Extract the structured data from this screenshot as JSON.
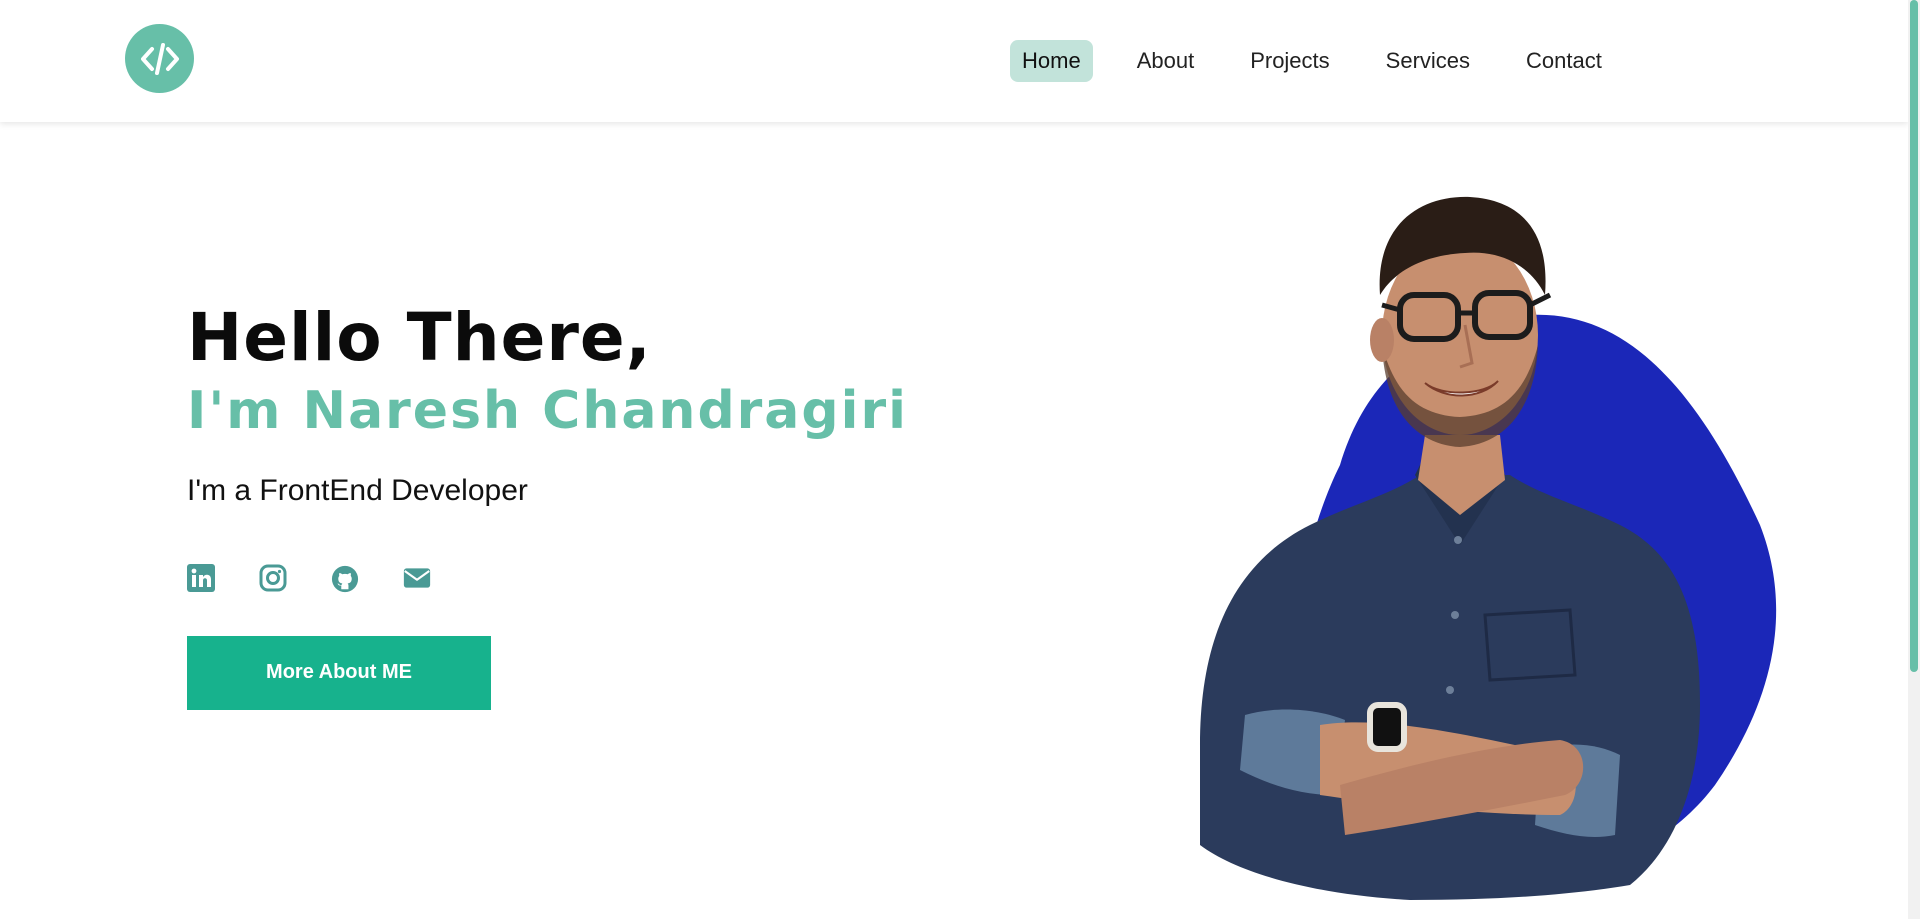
{
  "nav": {
    "items": [
      {
        "label": "Home",
        "active": true
      },
      {
        "label": "About",
        "active": false
      },
      {
        "label": "Projects",
        "active": false
      },
      {
        "label": "Services",
        "active": false
      },
      {
        "label": "Contact",
        "active": false
      }
    ]
  },
  "logo": {
    "icon": "code-brackets-icon"
  },
  "hero": {
    "greeting": "Hello There,",
    "name": "I'm Naresh Chandragiri",
    "role": "I'm a FrontEnd Developer",
    "cta_label": "More About ME"
  },
  "socials": [
    {
      "icon": "linkedin-icon"
    },
    {
      "icon": "instagram-icon"
    },
    {
      "icon": "github-icon"
    },
    {
      "icon": "email-icon"
    }
  ],
  "colors": {
    "accent": "#67bfa8",
    "button": "#17b28d",
    "nav_active_bg": "#c2e3da",
    "social_icon": "#4a9a95",
    "blob": "#1b27b8"
  }
}
